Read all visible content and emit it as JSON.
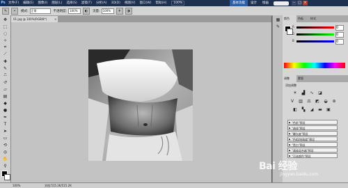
{
  "app": {
    "logo": "Ps"
  },
  "menus": [
    "文件(F)",
    "编辑(E)",
    "图像(I)",
    "图层(L)",
    "选择(S)",
    "滤镜(T)",
    "分析(A)",
    "3D(D)",
    "视图(V)",
    "窗口(W)",
    "帮助(H)"
  ],
  "top_zoom": "100%",
  "workspace": [
    "基本功能",
    "设计",
    "绘画"
  ],
  "options": {
    "mode_label": "模式:",
    "mode_value": "正常",
    "opacity_label": "不透明度:",
    "opacity_value": "100%",
    "flow_label": "流量:",
    "flow_value": "100%"
  },
  "document_tab": {
    "title": "01.jpg @ 100%(RGB/8*)",
    "close": "×"
  },
  "status": {
    "zoom": "100%",
    "doc": "文档:515.2K/515.2K"
  },
  "color_panel": {
    "tabs": [
      "颜色",
      "色板",
      "样式"
    ],
    "channels": [
      {
        "label": "R",
        "value": "0"
      },
      {
        "label": "G",
        "value": "0"
      },
      {
        "label": "B",
        "value": "0"
      }
    ]
  },
  "adjust_panel": {
    "tabs": [
      "调整",
      "蒙版"
    ],
    "title": "添加调整",
    "presets": [
      "\"色阶\"预设",
      "\"曲线\"预设",
      "\"曝光度\"预设",
      "\"色相/饱和度\"预设",
      "\"黑白\"预设",
      "\"通道混合器\"预设",
      "\"可选颜色\"预设"
    ]
  },
  "watermark": {
    "main": "Bai 经验",
    "sub": "jingyan.baidu.com"
  },
  "colors": {
    "title_bar": "#1e3050",
    "workspace_active": "#2d5fa6",
    "canvas_bg": "#c3c3c3",
    "panel_bg": "#d6d6d6"
  }
}
